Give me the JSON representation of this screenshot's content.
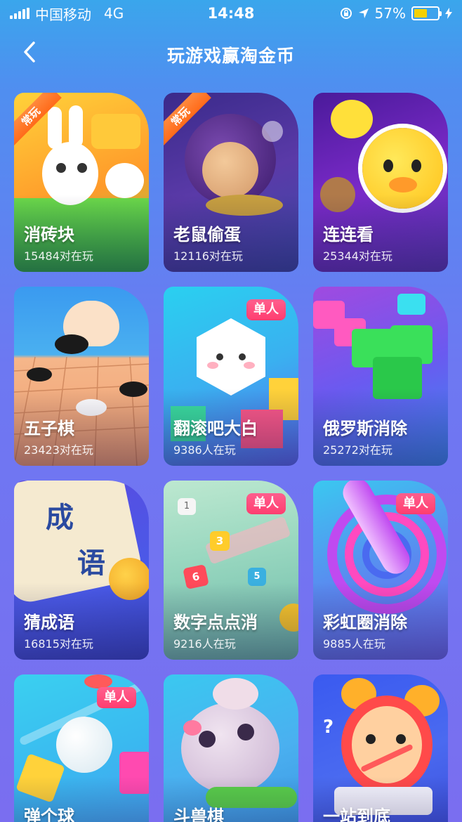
{
  "status_bar": {
    "carrier": "中国移动",
    "network": "4G",
    "time": "14:48",
    "battery_percent": "57%",
    "battery_level": 0.57,
    "battery_color": "#f5d000"
  },
  "nav": {
    "back_icon": "chevron-left-icon",
    "title": "玩游戏赢淘金币"
  },
  "games": [
    {
      "name": "消砖块",
      "players": "15484对在玩",
      "tag": "常玩",
      "tag_type": "ribbon"
    },
    {
      "name": "老鼠偷蛋",
      "players": "12116对在玩",
      "tag": "常玩",
      "tag_type": "ribbon"
    },
    {
      "name": "连连看",
      "players": "25344对在玩",
      "tag": "",
      "tag_type": ""
    },
    {
      "name": "五子棋",
      "players": "23423对在玩",
      "tag": "",
      "tag_type": ""
    },
    {
      "name": "翻滚吧大白",
      "players": "9386人在玩",
      "tag": "单人",
      "tag_type": "badge"
    },
    {
      "name": "俄罗斯消除",
      "players": "25272对在玩",
      "tag": "",
      "tag_type": ""
    },
    {
      "name": "猜成语",
      "players": "16815对在玩",
      "tag": "",
      "tag_type": "",
      "art_text": [
        "成",
        "语"
      ]
    },
    {
      "name": "数字点点消",
      "players": "9216人在玩",
      "tag": "单人",
      "tag_type": "badge",
      "art_text": [
        "1",
        "3",
        "6",
        "5"
      ]
    },
    {
      "name": "彩虹圈消除",
      "players": "9885人在玩",
      "tag": "单人",
      "tag_type": "badge"
    },
    {
      "name": "弹个球",
      "players": "",
      "tag": "单人",
      "tag_type": "badge"
    },
    {
      "name": "斗兽棋",
      "players": "",
      "tag": "",
      "tag_type": ""
    },
    {
      "name": "一站到底",
      "players": "",
      "tag": "",
      "tag_type": ""
    }
  ]
}
